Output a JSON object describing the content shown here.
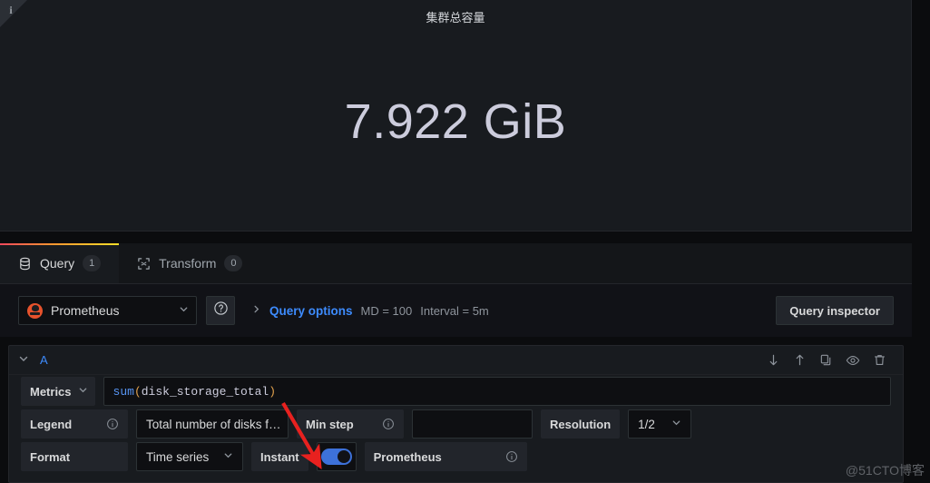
{
  "panel": {
    "title": "集群总容量",
    "info_icon": "info-icon",
    "stat_value": "7.922 GiB"
  },
  "tabs": [
    {
      "label": "Query",
      "badge": "1",
      "icon": "database-icon",
      "active": true
    },
    {
      "label": "Transform",
      "badge": "0",
      "icon": "transform-icon",
      "active": false
    }
  ],
  "datasource_row": {
    "datasource_name": "Prometheus",
    "datasource_logo": "prometheus-logo",
    "help_icon": "help-circle-icon",
    "query_options": {
      "caret": "chevron-right-icon",
      "label": "Query options",
      "max_data_points": "MD = 100",
      "interval": "Interval = 5m"
    },
    "query_inspector_label": "Query inspector"
  },
  "query_row": {
    "collapse_icon": "chevron-down-icon",
    "ref_id": "A",
    "actions": [
      {
        "name": "move-query-down-icon"
      },
      {
        "name": "move-query-up-icon"
      },
      {
        "name": "duplicate-query-icon"
      },
      {
        "name": "toggle-visibility-eye-icon"
      },
      {
        "name": "delete-query-trash-icon"
      }
    ],
    "metrics": {
      "label": "Metrics",
      "caret": "chevron-down-icon",
      "expression_fn": "sum",
      "expression_open": "(",
      "expression_arg": "disk_storage_total",
      "expression_close": ")"
    },
    "legend": {
      "label": "Legend",
      "info_icon": "info-circle-icon",
      "value": "Total number of disks f…"
    },
    "min_step": {
      "label": "Min step",
      "info_icon": "info-circle-icon",
      "value": ""
    },
    "resolution": {
      "label": "Resolution",
      "value": "1/2",
      "caret": "chevron-down-icon"
    },
    "format": {
      "label": "Format",
      "value": "Time series",
      "caret": "chevron-down-icon"
    },
    "instant": {
      "label": "Instant",
      "toggle_on": true,
      "toggle_icon": "toggle-switch-on"
    },
    "datasource_pill": {
      "label": "Prometheus",
      "info_icon": "info-circle-icon"
    }
  },
  "annotation": {
    "arrow": "red-annotation-arrow",
    "color": "#e8211f"
  },
  "watermark": "@51CTO博客",
  "colors": {
    "accent_blue": "#3d8bfd",
    "toggle_blue": "#3d71d9",
    "prometheus_orange": "#e6522c",
    "panel_bg": "#181b1f",
    "page_bg": "#111217"
  }
}
